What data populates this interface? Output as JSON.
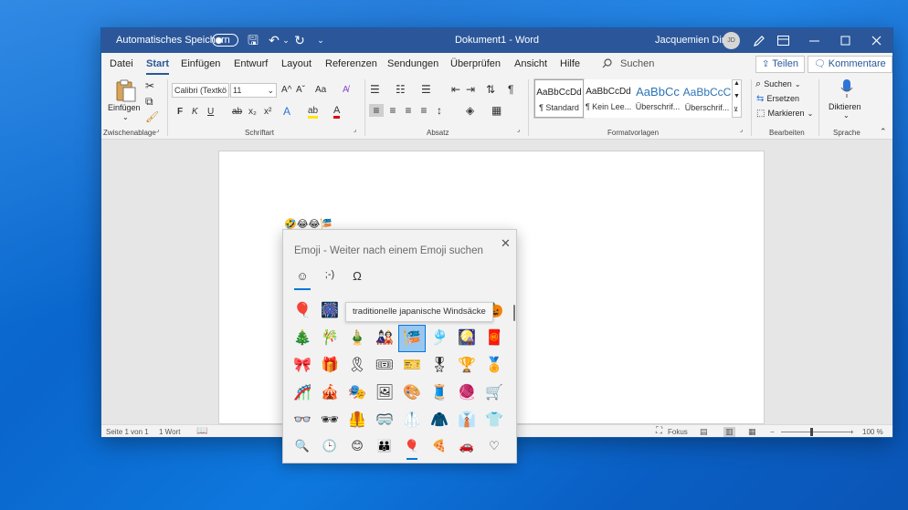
{
  "titlebar": {
    "autosave_label": "Automatisches Speichern",
    "doc_title": "Dokument1  -  Word",
    "user_name": "Jacquemien Dirk",
    "avatar_initials": "JD",
    "undo_glyph": "↶",
    "redo_glyph": "↻",
    "save_glyph": "🖫",
    "dropdown_glyph": "⌄"
  },
  "menu": {
    "items": [
      "Datei",
      "Start",
      "Einfügen",
      "Entwurf",
      "Layout",
      "Referenzen",
      "Sendungen",
      "Überprüfen",
      "Ansicht",
      "Hilfe"
    ],
    "search_label": "Suchen",
    "share_label": "Teilen",
    "comments_label": "Kommentare"
  },
  "ribbon": {
    "clipboard": {
      "paste_label": "Einfügen",
      "group_label": "Zwischenablage"
    },
    "font": {
      "font_name": "Calibri (Textkö",
      "font_size": "11",
      "group_label": "Schriftart",
      "bold": "F",
      "italic": "K",
      "underline": "U",
      "strike": "ab",
      "sub": "x₂",
      "sup": "x²",
      "grow": "A^",
      "shrink": "Aˇ",
      "case": "Aa",
      "effects": "A",
      "highlight": "ab",
      "color": "A"
    },
    "paragraph": {
      "group_label": "Absatz",
      "pilcrow": "¶"
    },
    "styles": {
      "group_label": "Formatvorlagen",
      "items": [
        {
          "preview": "AaBbCcDd",
          "name": "¶ Standard"
        },
        {
          "preview": "AaBbCcDd",
          "name": "¶ Kein Lee..."
        },
        {
          "preview": "AaBbCc",
          "name": "Überschrif..."
        },
        {
          "preview": "AaBbCcC",
          "name": "Überschrif..."
        }
      ]
    },
    "editing": {
      "group_label": "Bearbeiten",
      "find": "Suchen",
      "replace": "Ersetzen",
      "select": "Markieren"
    },
    "voice": {
      "group_label": "Sprache",
      "dictate": "Diktieren"
    }
  },
  "document": {
    "inserted_emojis": "🤣😂😂🎏"
  },
  "statusbar": {
    "page": "Seite 1 von 1",
    "words": "1 Wort",
    "focus": "Fokus",
    "zoom": "100 %",
    "zoom_minus": "−",
    "zoom_plus": "+"
  },
  "emoji_panel": {
    "title": "Emoji - Weiter nach einem Emoji suchen",
    "close_glyph": "✕",
    "tabs": [
      "☺",
      ";-)",
      "Ω"
    ],
    "tooltip": "traditionelle japanische Windsäcke",
    "grid": [
      [
        "🎈",
        "🎆",
        "",
        "",
        "",
        "",
        "",
        "🎃"
      ],
      [
        "🎄",
        "🎋",
        "🎍",
        "🎎",
        "🎏",
        "🎐",
        "🎑",
        "🧧"
      ],
      [
        "🎀",
        "🎁",
        "🎗",
        "🎟",
        "🎫",
        "🎖",
        "🏆",
        "🏅"
      ],
      [
        "🎢",
        "🎪",
        "🎭",
        "🖼",
        "🎨",
        "🧵",
        "🧶",
        "🛒"
      ],
      [
        "👓",
        "🕶",
        "🦺",
        "🥽",
        "🥼",
        "🧥",
        "👔",
        "👕"
      ]
    ],
    "selected_emoji": "🎏",
    "categories": [
      "🔍",
      "🕒",
      "😊",
      "👪",
      "🎈",
      "🍕",
      "🚗",
      "♡"
    ]
  }
}
